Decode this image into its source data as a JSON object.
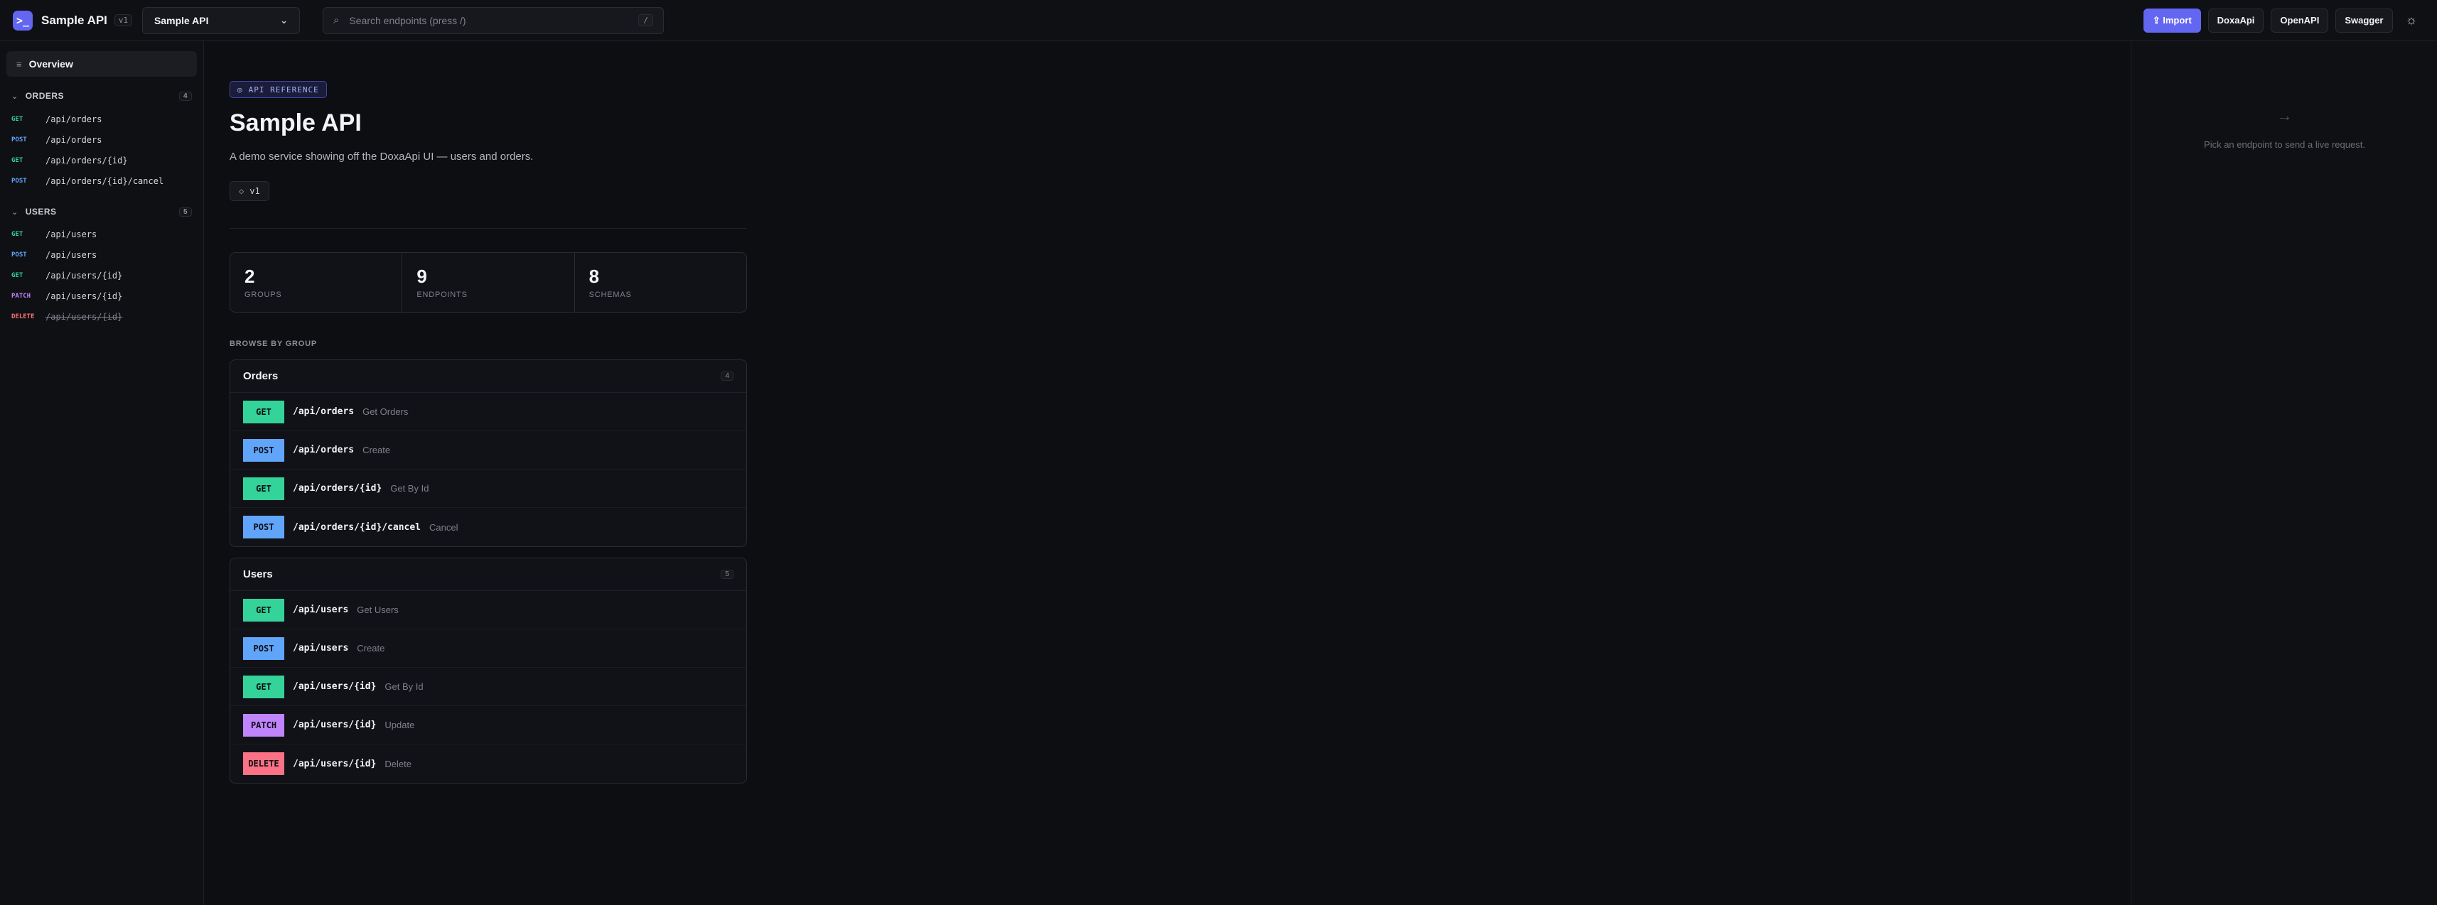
{
  "app": {
    "logo_glyph": ">_",
    "name": "Sample API",
    "version_badge": "v1"
  },
  "api_select": {
    "value": "Sample API",
    "chevron_icon": "chevron-down-icon"
  },
  "search": {
    "placeholder": "Search endpoints (press /)",
    "value": "",
    "shortcut": "/"
  },
  "actions": {
    "import_label": "⇪ Import",
    "doxa_label": "DoxaApi",
    "openapi_label": "OpenAPI",
    "swagger_label": "Swagger",
    "theme_icon": "sun-icon"
  },
  "sidebar": {
    "overview_label": "Overview",
    "groups": [
      {
        "label": "ORDERS",
        "count": "4",
        "items": [
          {
            "method": "GET",
            "path": "/api/orders"
          },
          {
            "method": "POST",
            "path": "/api/orders"
          },
          {
            "method": "GET",
            "path": "/api/orders/{id}"
          },
          {
            "method": "POST",
            "path": "/api/orders/{id}/cancel"
          }
        ]
      },
      {
        "label": "USERS",
        "count": "5",
        "items": [
          {
            "method": "GET",
            "path": "/api/users"
          },
          {
            "method": "POST",
            "path": "/api/users"
          },
          {
            "method": "GET",
            "path": "/api/users/{id}"
          },
          {
            "method": "PATCH",
            "path": "/api/users/{id}"
          },
          {
            "method": "DELETE",
            "path": "/api/users/{id}"
          }
        ]
      }
    ]
  },
  "main": {
    "badge": "API REFERENCE",
    "title": "Sample API",
    "subtitle": "A demo service showing off the DoxaApi UI — users and orders.",
    "version_chip": "v1",
    "stats": [
      {
        "value": "2",
        "label": "GROUPS"
      },
      {
        "value": "9",
        "label": "ENDPOINTS"
      },
      {
        "value": "8",
        "label": "SCHEMAS"
      }
    ],
    "browse_label": "BROWSE BY GROUP",
    "groups": [
      {
        "name": "Orders",
        "count": "4",
        "endpoints": [
          {
            "method": "GET",
            "path": "/api/orders",
            "summary": "Get Orders"
          },
          {
            "method": "POST",
            "path": "/api/orders",
            "summary": "Create"
          },
          {
            "method": "GET",
            "path": "/api/orders/{id}",
            "summary": "Get By Id"
          },
          {
            "method": "POST",
            "path": "/api/orders/{id}/cancel",
            "summary": "Cancel"
          }
        ]
      },
      {
        "name": "Users",
        "count": "5",
        "endpoints": [
          {
            "method": "GET",
            "path": "/api/users",
            "summary": "Get Users"
          },
          {
            "method": "POST",
            "path": "/api/users",
            "summary": "Create"
          },
          {
            "method": "GET",
            "path": "/api/users/{id}",
            "summary": "Get By Id"
          },
          {
            "method": "PATCH",
            "path": "/api/users/{id}",
            "summary": "Update"
          },
          {
            "method": "DELETE",
            "path": "/api/users/{id}",
            "summary": "Delete"
          }
        ]
      }
    ]
  },
  "right_panel": {
    "hint": "Pick an endpoint to send a live request.",
    "arrow_icon": "arrow-right-icon"
  },
  "colors": {
    "accent": "#6366f1",
    "get": "#34d399",
    "post": "#60a5fa",
    "patch": "#c084fc",
    "delete": "#fb7185"
  }
}
